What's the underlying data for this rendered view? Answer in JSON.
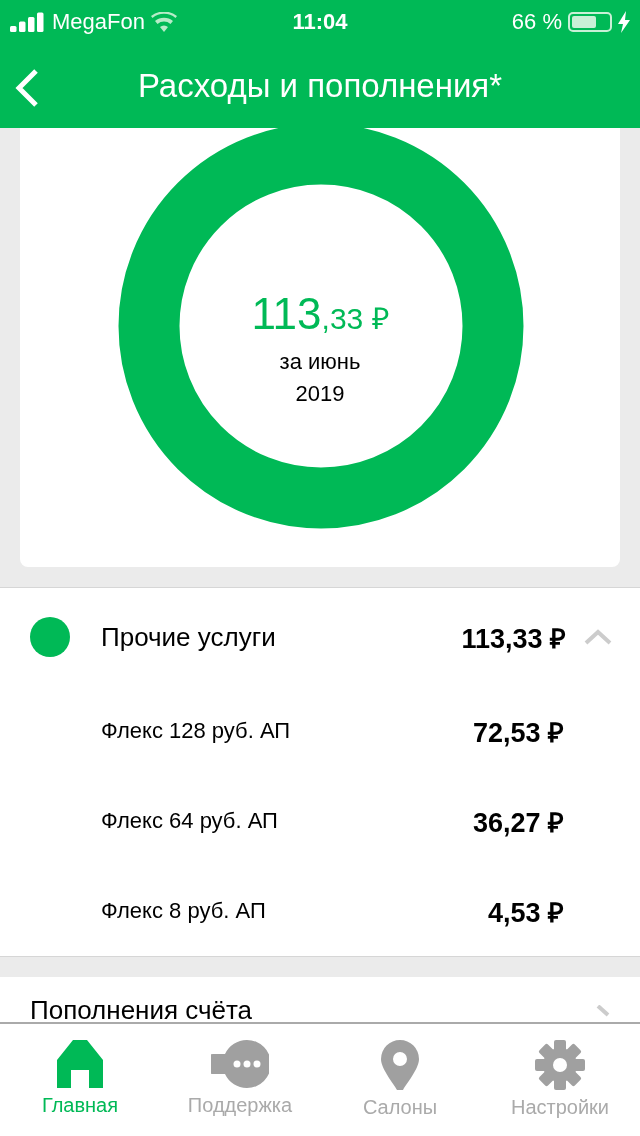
{
  "status_bar": {
    "carrier": "MegaFon",
    "time": "11:04",
    "battery": "66 %"
  },
  "header": {
    "title": "Расходы и пополнения*"
  },
  "summary": {
    "amount_whole": "113",
    "amount_fraction": ",33 ₽",
    "period": "за июнь",
    "year": "2019"
  },
  "categories": [
    {
      "name": "Прочие услуги",
      "amount": "113,33 ₽",
      "color": "#00b956",
      "expanded": true,
      "items": [
        {
          "name": "Флекс 128 руб. АП",
          "amount": "72,53 ₽"
        },
        {
          "name": "Флекс 64 руб. АП",
          "amount": "36,27 ₽"
        },
        {
          "name": "Флекс 8 руб. АП",
          "amount": "4,53 ₽"
        }
      ]
    }
  ],
  "topups": {
    "label": "Пополнения счёта"
  },
  "tabs": [
    {
      "label": "Главная",
      "selected": true
    },
    {
      "label": "Поддержка",
      "selected": false
    },
    {
      "label": "Салоны",
      "selected": false
    },
    {
      "label": "Настройки",
      "selected": false
    }
  ]
}
